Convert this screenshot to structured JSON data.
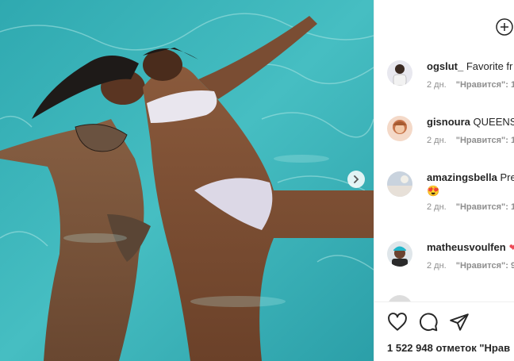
{
  "post": {
    "image_alt": "Two women floating in a turquoise pool",
    "next_icon": "chevron-right-icon"
  },
  "header": {
    "add_icon": "plus-circle-icon"
  },
  "comments": [
    {
      "user": "ogslut_",
      "text": "Favorite fr",
      "age": "2 дн.",
      "like_label": "\"Нравится\": 1"
    },
    {
      "user": "gisnoura",
      "text": "QUEENS",
      "age": "2 дн.",
      "like_label": "\"Нравится\": 1"
    },
    {
      "user": "amazingsbella",
      "text": "Pre",
      "emoji": "😍",
      "age": "2 дн.",
      "like_label": "\"Нравится\": 1"
    },
    {
      "user": "matheusvoulfen",
      "text": "",
      "age": "2 дн.",
      "like_label": "\"Нравится\": 9"
    }
  ],
  "actions": {
    "like_icon": "heart-icon",
    "comment_icon": "comment-icon",
    "share_icon": "send-icon",
    "likes_text": "1 522 948 отметок \"Нрав"
  },
  "colors": {
    "water": "#3fb3b8",
    "text": "#262626",
    "meta": "#8e8e8e",
    "border": "#efefef"
  }
}
